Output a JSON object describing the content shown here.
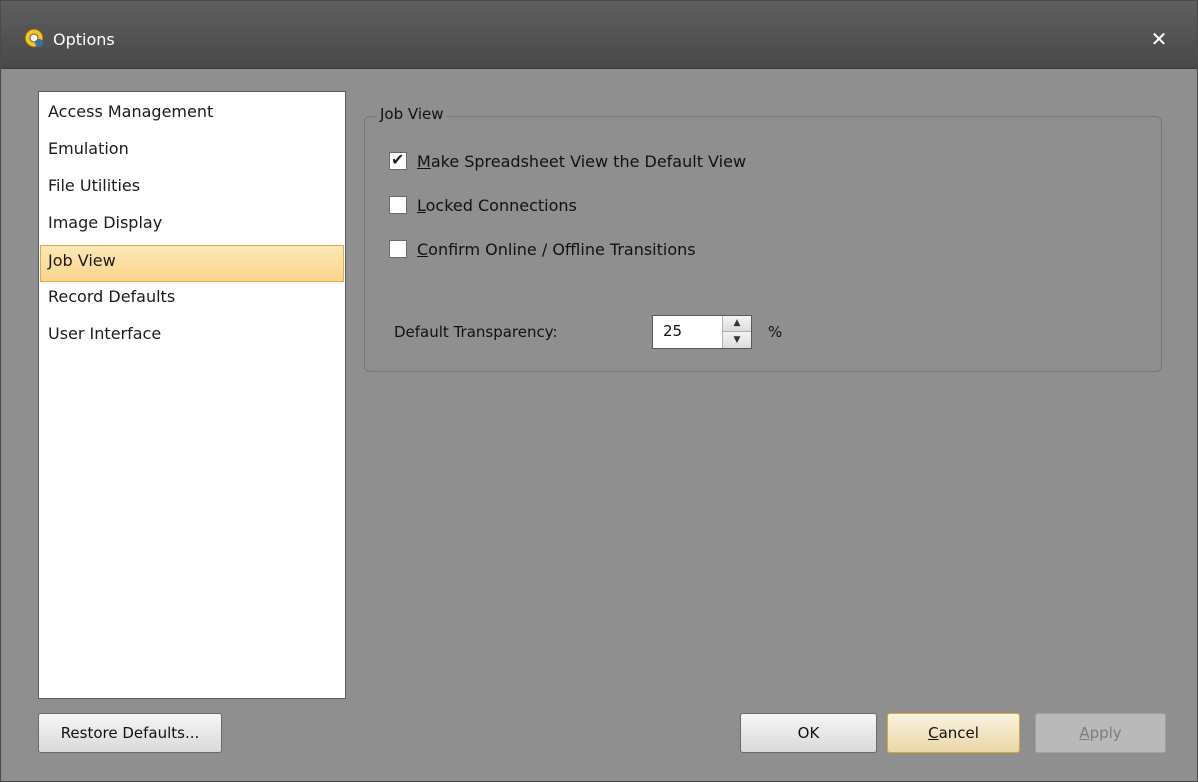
{
  "window": {
    "title": "Options",
    "close_glyph": "✕"
  },
  "sidebar": {
    "items": [
      {
        "label": "Access Management"
      },
      {
        "label": "Emulation"
      },
      {
        "label": "File Utilities"
      },
      {
        "label": "Image Display"
      },
      {
        "label": "Job View",
        "selected": true
      },
      {
        "label": "Record Defaults"
      },
      {
        "label": "User Interface"
      }
    ]
  },
  "job_view": {
    "group_title": "Job View",
    "options": [
      {
        "mnemonic": "M",
        "rest": "ake Spreadsheet View the Default View",
        "checked": true
      },
      {
        "mnemonic": "L",
        "rest": "ocked Connections",
        "checked": false
      },
      {
        "mnemonic": "C",
        "rest": "onfirm Online / Offline Transitions",
        "checked": false
      }
    ],
    "transparency_label": "Default Transparency:",
    "transparency_value": "25",
    "transparency_unit": "%"
  },
  "buttons": {
    "restore_defaults": "Restore Defaults...",
    "ok": "OK",
    "cancel_mnemonic": "C",
    "cancel_rest": "ancel",
    "apply_mnemonic": "A",
    "apply_rest": "pply"
  },
  "icons": {
    "app": "options-app-icon",
    "close": "close-icon",
    "check": "check-icon"
  },
  "colors": {
    "selection": "#fad58a",
    "selection_border": "#e2a94c",
    "background": "#8f8f8f"
  }
}
